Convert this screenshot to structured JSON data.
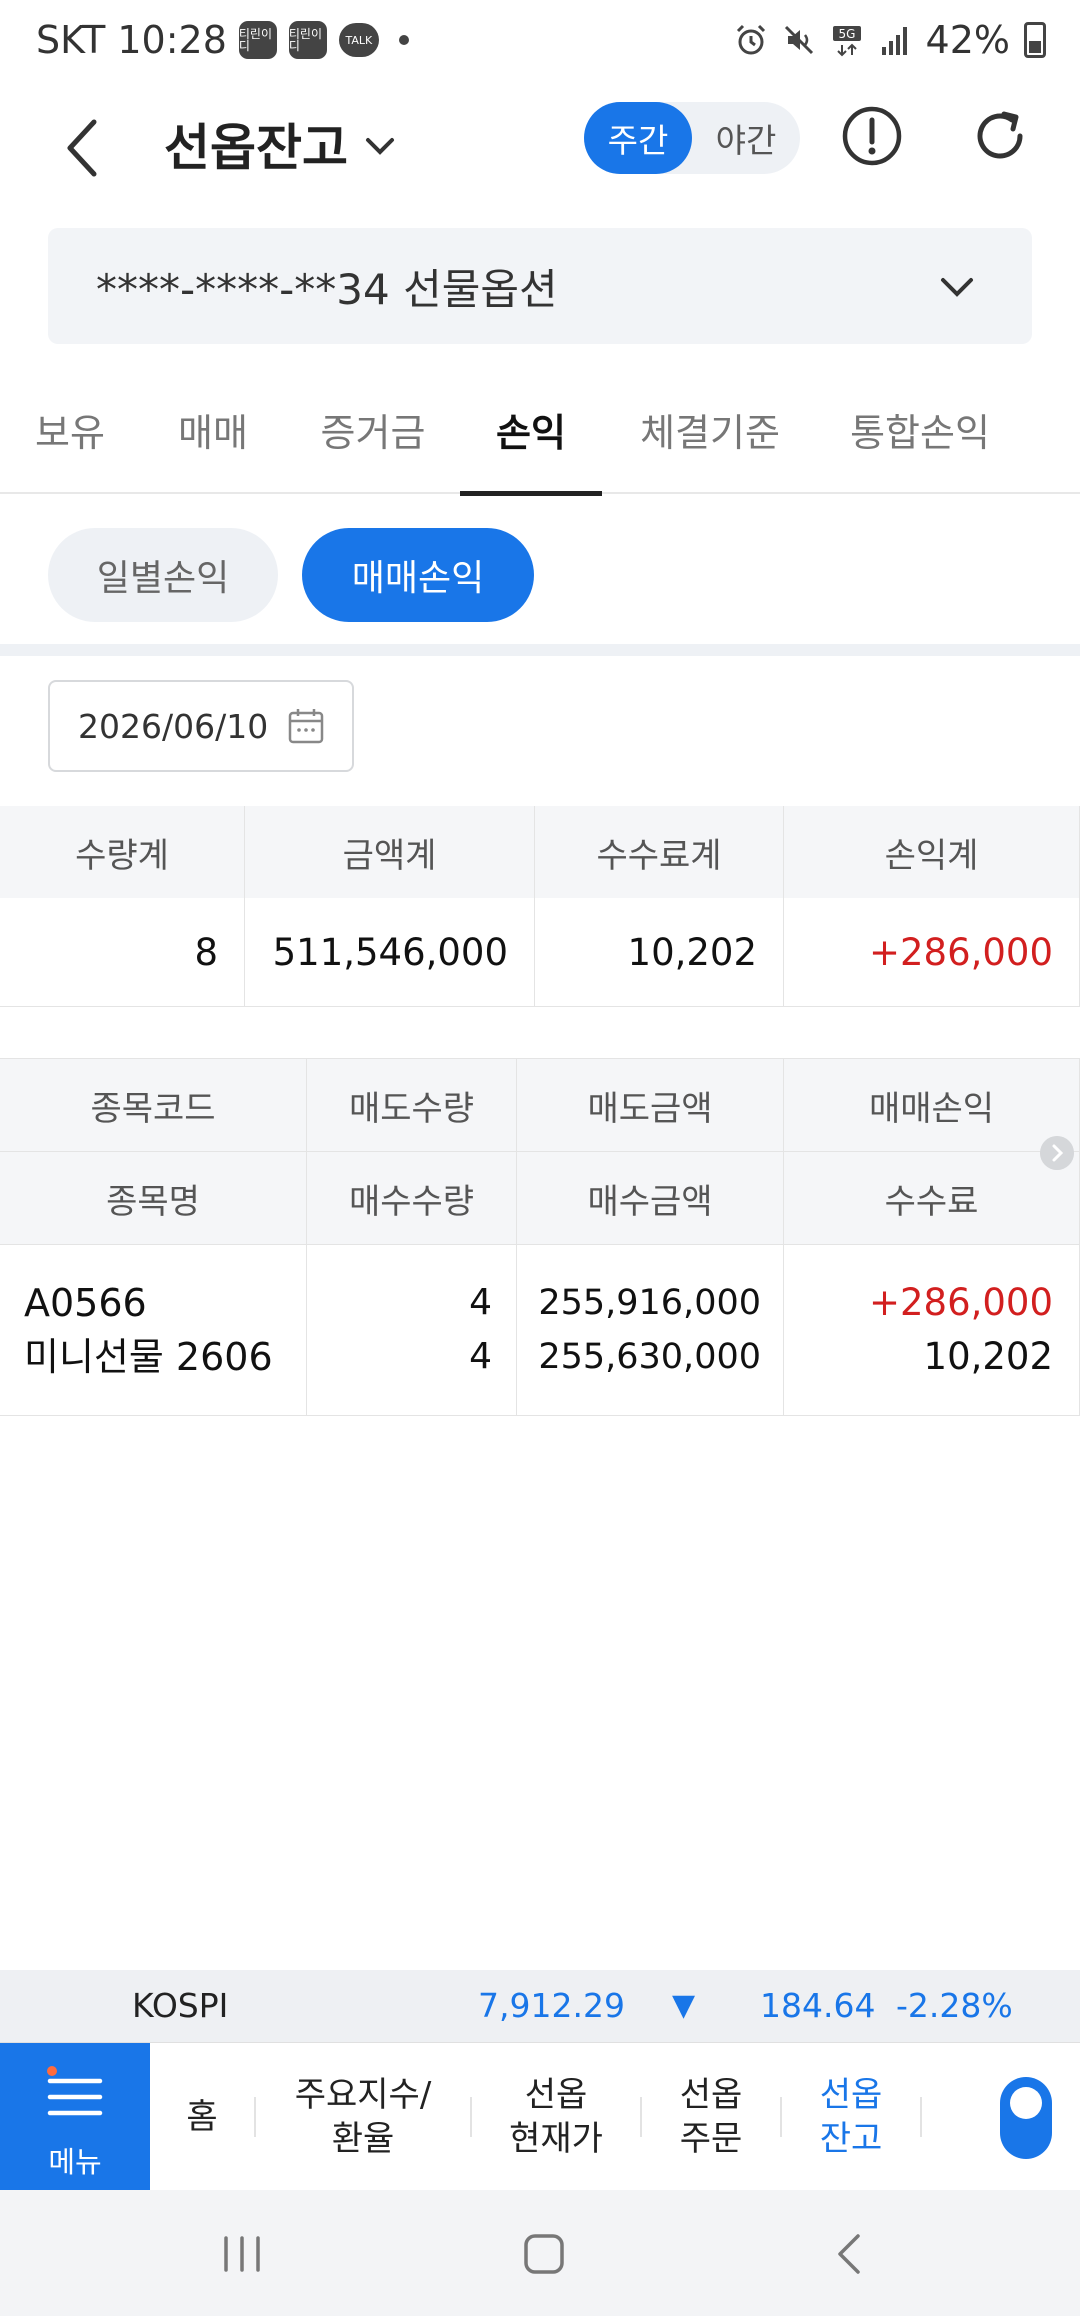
{
  "status_bar": {
    "carrier_time": "SKT 10:28",
    "badge1": "티린이디",
    "badge2": "티린이디",
    "talk": "TALK",
    "battery": "42%"
  },
  "header": {
    "title": "선옵잔고",
    "session_day": "주간",
    "session_night": "야간"
  },
  "account": {
    "label": "****-****-**34 선물옵션"
  },
  "tabs": [
    "보유",
    "매매",
    "증거금",
    "손익",
    "체결기준",
    "통합손익"
  ],
  "subtabs": {
    "daily": "일별손익",
    "trade": "매매손익"
  },
  "date_filter": {
    "value": "2026/06/10"
  },
  "summary": {
    "headers": [
      "수량계",
      "금액계",
      "수수료계",
      "손익계"
    ],
    "values": [
      "8",
      "511,546,000",
      "10,202",
      "+286,000"
    ]
  },
  "detail": {
    "header_row1": [
      "종목코드",
      "매도수량",
      "매도금액",
      "매매손익"
    ],
    "header_row2": [
      "종목명",
      "매수수량",
      "매수금액",
      "수수료"
    ],
    "rows": [
      {
        "code": "A0566",
        "name": "미니선물 2606",
        "sell_qty": "4",
        "buy_qty": "4",
        "sell_amt": "255,916,000",
        "buy_amt": "255,630,000",
        "pnl": "+286,000",
        "fee": "10,202"
      }
    ]
  },
  "ticker": {
    "name": "KOSPI",
    "value": "7,912.29",
    "arrow": "▼",
    "change": "184.64",
    "pct": "-2.28%"
  },
  "bottom_nav": {
    "menu": "메뉴",
    "home": "홈",
    "index_l1": "주요지수/",
    "index_l2": "환율",
    "price_l1": "선옵",
    "price_l2": "현재가",
    "order_l1": "선옵",
    "order_l2": "주문",
    "balance_l1": "선옵",
    "balance_l2": "잔고"
  },
  "colors": {
    "accent": "#1976e8",
    "profit": "#d21f1f"
  }
}
